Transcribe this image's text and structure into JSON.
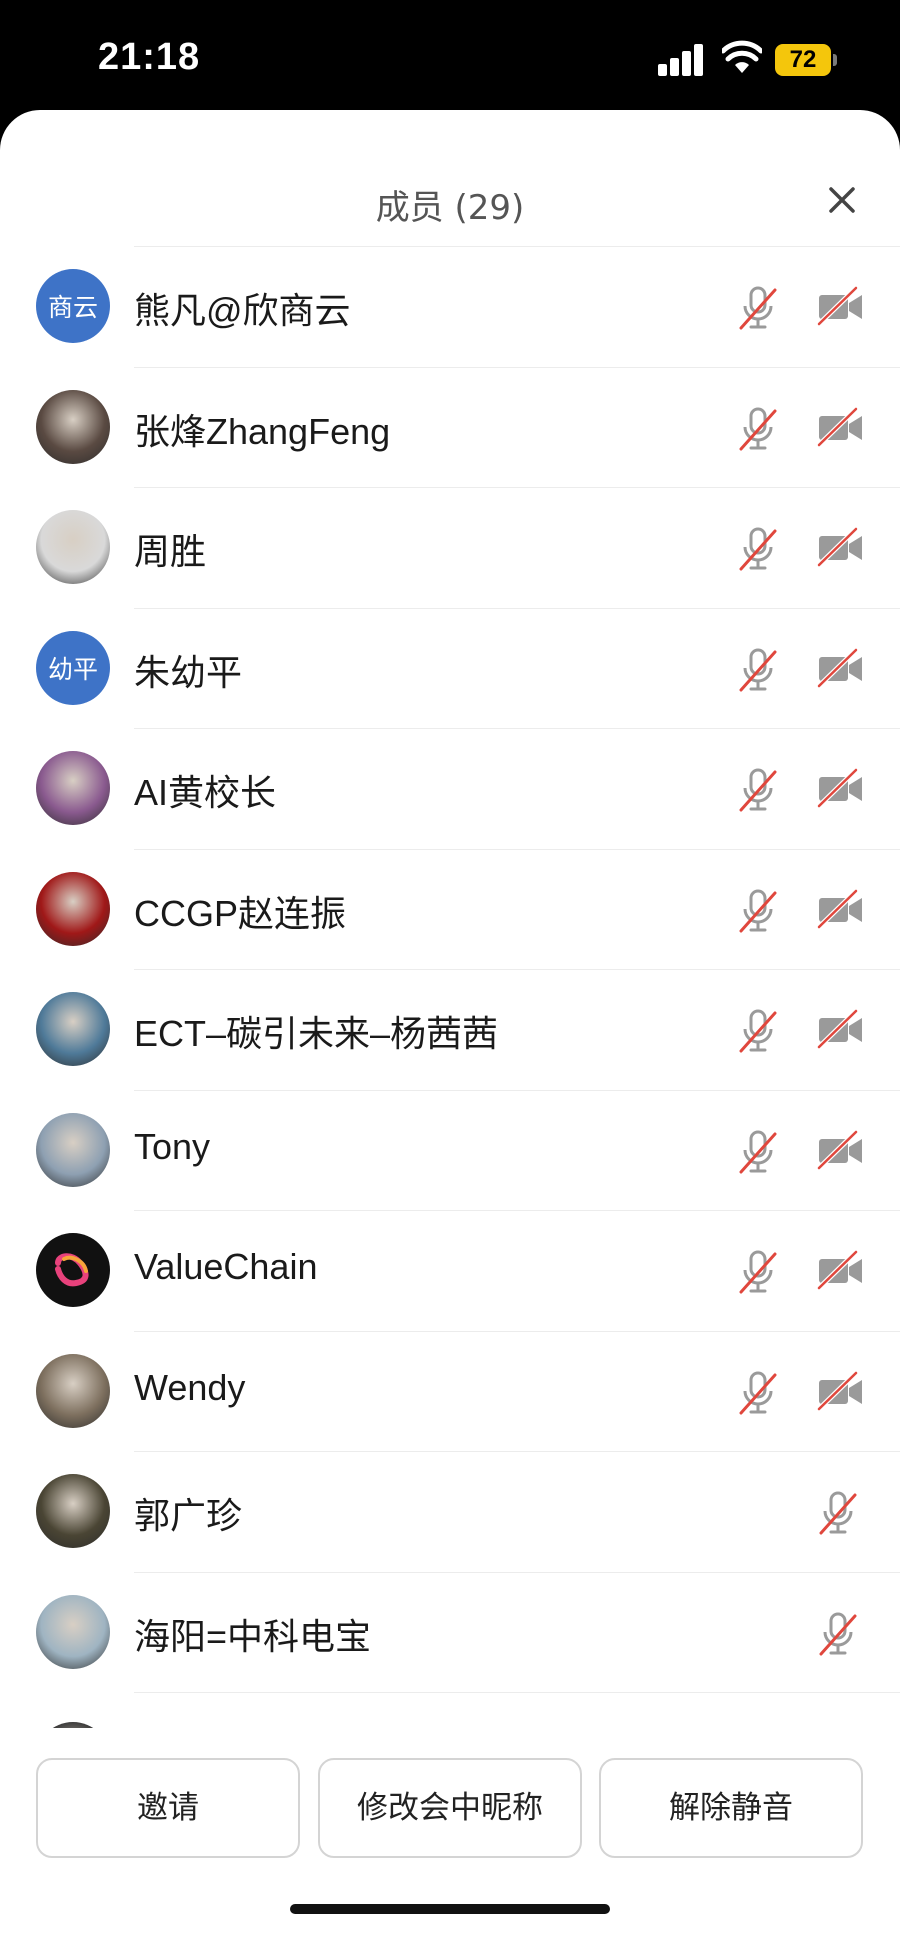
{
  "status_bar": {
    "time": "21:18",
    "battery": "72"
  },
  "header": {
    "title": "成员 (29)"
  },
  "members": [
    {
      "name": "熊凡@欣商云",
      "avatar_text": "商云",
      "avatar_type": "text",
      "mic": "muted",
      "camera": "off"
    },
    {
      "name": "张烽ZhangFeng",
      "avatar_type": "photo",
      "avatar_color": "#5a4a42",
      "mic": "muted",
      "camera": "off"
    },
    {
      "name": "周胜",
      "avatar_type": "photo",
      "avatar_color": "#d9d9d9",
      "mic": "muted",
      "camera": "off"
    },
    {
      "name": "朱幼平",
      "avatar_text": "幼平",
      "avatar_type": "text",
      "mic": "muted",
      "camera": "off"
    },
    {
      "name": "AI黄校长",
      "avatar_type": "photo",
      "avatar_color": "#8a5a8f",
      "mic": "muted",
      "camera": "off"
    },
    {
      "name": "CCGP赵连振",
      "avatar_type": "photo",
      "avatar_color": "#a01818",
      "mic": "muted",
      "camera": "off"
    },
    {
      "name": "ECT–碳引未来–杨茜茜",
      "avatar_type": "photo",
      "avatar_color": "#4f7a99",
      "mic": "muted",
      "camera": "off"
    },
    {
      "name": "Tony",
      "avatar_type": "photo",
      "avatar_color": "#8ea0b2",
      "mic": "muted",
      "camera": "off"
    },
    {
      "name": "ValueChain",
      "avatar_type": "logo",
      "avatar_color": "#111111",
      "mic": "muted",
      "camera": "off"
    },
    {
      "name": "Wendy",
      "avatar_type": "photo",
      "avatar_color": "#7d6f5e",
      "mic": "muted",
      "camera": "off"
    },
    {
      "name": "郭广珍",
      "avatar_type": "photo",
      "avatar_color": "#4a4534",
      "mic": "muted",
      "camera": "none"
    },
    {
      "name": "海阳=中科电宝",
      "avatar_type": "photo",
      "avatar_color": "#9fb4c2",
      "mic": "muted",
      "camera": "none"
    },
    {
      "name": "",
      "avatar_type": "photo",
      "avatar_color": "#333333",
      "mic": "none",
      "camera": "none"
    }
  ],
  "footer": {
    "invite_label": "邀请",
    "rename_label": "修改会中昵称",
    "unmute_label": "解除静音"
  },
  "colors": {
    "accent_text_avatar": "#3e73c7",
    "muted_slash": "#e0473d",
    "icon_gray": "#9a9a9a"
  }
}
